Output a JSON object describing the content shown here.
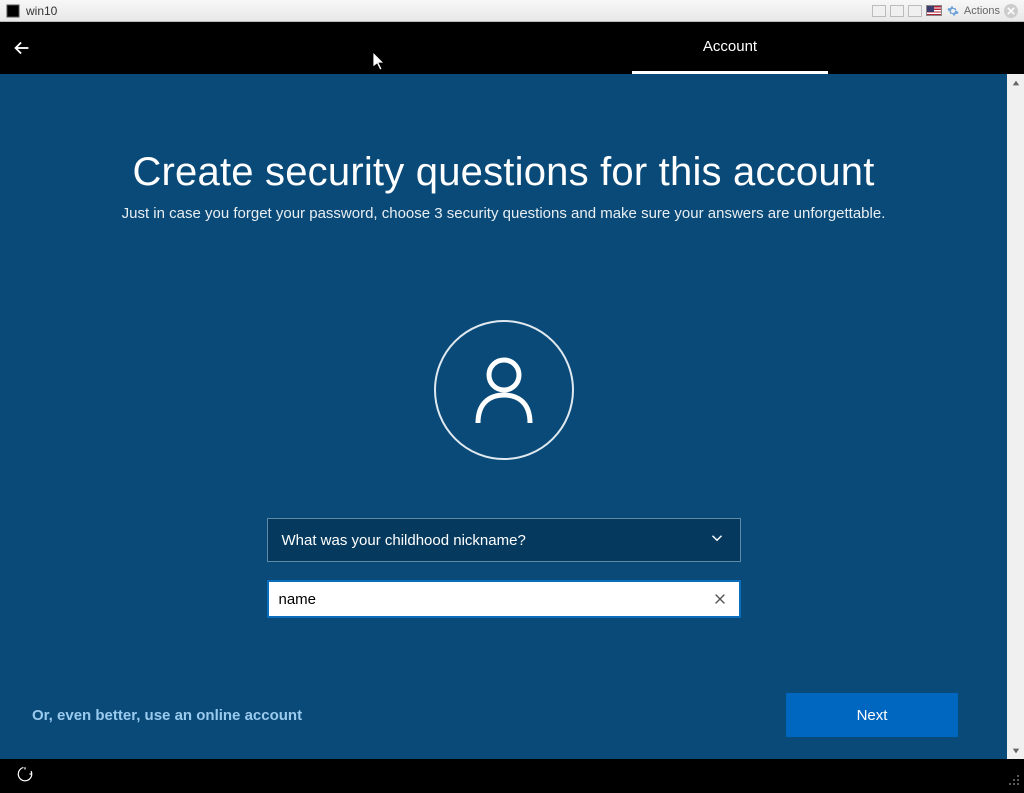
{
  "titlebar": {
    "title": "win10",
    "actions_label": "Actions"
  },
  "nav": {
    "tab_label": "Account"
  },
  "page": {
    "title": "Create security questions for this account",
    "subtitle": "Just in case you forget your password, choose 3 security questions and make sure your answers are unforgettable."
  },
  "form": {
    "selected_question": "What was your childhood nickname?",
    "answer_value": "name"
  },
  "footer": {
    "online_link": "Or, even better, use an online account",
    "next_label": "Next"
  }
}
